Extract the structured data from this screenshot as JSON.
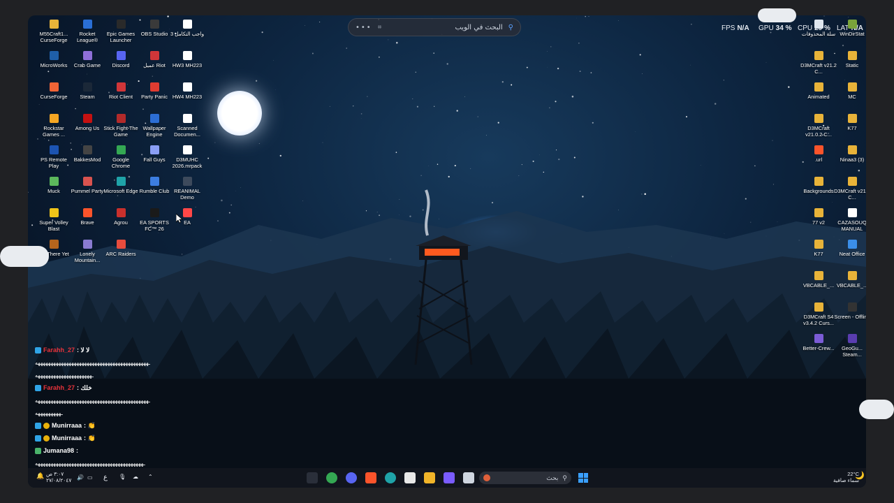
{
  "websearch": {
    "placeholder": "البحث في الويب",
    "more": "•••"
  },
  "stats": {
    "fps_label": "FPS",
    "fps": "N/A",
    "gpu_label": "GPU",
    "gpu": "34 %",
    "cpu_label": "CPU",
    "cpu": "29 %",
    "lat_label": "LAT",
    "lat": "N/A"
  },
  "desktop_left": [
    {
      "label": "M55Craft1... CurseForge",
      "icon": "folder-icon",
      "color": "#e8b339"
    },
    {
      "label": "Rocket League®",
      "icon": "rocket-league-icon",
      "color": "#2a6fd6"
    },
    {
      "label": "Epic Games Launcher",
      "icon": "epic-games-icon",
      "color": "#2a2a2a"
    },
    {
      "label": "OBS Studio",
      "icon": "obs-icon",
      "color": "#3a3a3a"
    },
    {
      "label": "واجب التكامل 3",
      "icon": "document-icon",
      "color": "#ffffff"
    },
    {
      "label": "MicroWorks",
      "icon": "microworks-icon",
      "color": "#1f5fa8"
    },
    {
      "label": "Crab Game",
      "icon": "crab-game-icon",
      "color": "#8f6fd8"
    },
    {
      "label": "Discord",
      "icon": "discord-icon",
      "color": "#5865f2"
    },
    {
      "label": "عميل Riot",
      "icon": "riot-icon",
      "color": "#d13639"
    },
    {
      "label": "HW3 MH223",
      "icon": "document-icon",
      "color": "#ffffff"
    },
    {
      "label": "CurseForge",
      "icon": "curseforge-icon",
      "color": "#f16436"
    },
    {
      "label": "Steam",
      "icon": "steam-icon",
      "color": "#1b2838"
    },
    {
      "label": "Riot Client",
      "icon": "riot-client-icon",
      "color": "#d13639"
    },
    {
      "label": "Party Panic",
      "icon": "party-panic-icon",
      "color": "#e03c31"
    },
    {
      "label": "HW4 MH223",
      "icon": "document-icon",
      "color": "#ffffff"
    },
    {
      "label": "Rockstar Games ...",
      "icon": "rockstar-icon",
      "color": "#f5a623"
    },
    {
      "label": "Among Us",
      "icon": "among-us-icon",
      "color": "#c51111"
    },
    {
      "label": "Stick Fight The Game",
      "icon": "stick-fight-icon",
      "color": "#b22a2a"
    },
    {
      "label": "Wallpaper Engine",
      "icon": "wallpaper-engine-icon",
      "color": "#2c6ed5"
    },
    {
      "label": "Scanned Documen...",
      "icon": "document-icon",
      "color": "#ffffff"
    },
    {
      "label": "PS Remote Play",
      "icon": "ps-remote-icon",
      "color": "#1c54b2"
    },
    {
      "label": "BakkesMod",
      "icon": "bakkesmod-icon",
      "color": "#444444"
    },
    {
      "label": "Google Chrome",
      "icon": "chrome-icon",
      "color": "#34a853"
    },
    {
      "label": "Fall Guys",
      "icon": "fall-guys-icon",
      "color": "#8a9ef5"
    },
    {
      "label": "D3MUHC 2026.mrpack",
      "icon": "file-icon",
      "color": "#ffffff"
    },
    {
      "label": "Muck",
      "icon": "muck-icon",
      "color": "#5cb85c"
    },
    {
      "label": "Pummel Party",
      "icon": "pummel-party-icon",
      "color": "#d9534f"
    },
    {
      "label": "Microsoft Edge",
      "icon": "edge-icon",
      "color": "#1fa3a8"
    },
    {
      "label": "Rumble Club",
      "icon": "rumble-club-icon",
      "color": "#3c7de0"
    },
    {
      "label": "REANIMAL Demo",
      "icon": "reanimal-icon",
      "color": "#3d4a5c"
    },
    {
      "label": "Super Volley Blast",
      "icon": "super-volley-icon",
      "color": "#f0c419"
    },
    {
      "label": "Brave",
      "icon": "brave-icon",
      "color": "#fb542b"
    },
    {
      "label": "Agrou",
      "icon": "agrou-icon",
      "color": "#c9302c"
    },
    {
      "label": "EA SPORTS FC™ 26",
      "icon": "ea-fc-icon",
      "color": "#1a1a1a"
    },
    {
      "label": "EA",
      "icon": "ea-icon",
      "color": "#ff4747"
    },
    {
      "label": "RV There Yet",
      "icon": "rv-there-yet-icon",
      "color": "#b5651d"
    },
    {
      "label": "Lonely Mountain...",
      "icon": "lonely-mountains-icon",
      "color": "#8a7bd1"
    },
    {
      "label": "ARC Raiders",
      "icon": "arc-raiders-icon",
      "color": "#e84c3d"
    }
  ],
  "desktop_right": [
    {
      "label": "سلة المحذوفات",
      "icon": "recycle-bin-icon",
      "color": "#dfe6ee"
    },
    {
      "label": "WinDirStat",
      "icon": "windirstat-icon",
      "color": "#7aa33a"
    },
    {
      "label": "D3MCraft v21.2 C...",
      "icon": "folder-icon",
      "color": "#e8b339"
    },
    {
      "label": "Static",
      "icon": "folder-icon",
      "color": "#e8b339"
    },
    {
      "label": "Animated",
      "icon": "folder-icon",
      "color": "#e8b339"
    },
    {
      "label": "MC",
      "icon": "folder-icon",
      "color": "#e8b339"
    },
    {
      "label": "D3MCraft v21.0.2 C...",
      "icon": "folder-icon",
      "color": "#e8b339"
    },
    {
      "label": "K77",
      "icon": "folder-icon",
      "color": "#e8b339"
    },
    {
      "label": ".url",
      "icon": "brave-icon",
      "color": "#fb542b"
    },
    {
      "label": "Ninaa3 (3)",
      "icon": "folder-icon",
      "color": "#e8b339"
    },
    {
      "label": "Backgrounds",
      "icon": "folder-icon",
      "color": "#e8b339"
    },
    {
      "label": "D3MCraft v21.1 C...",
      "icon": "folder-icon",
      "color": "#e8b339"
    },
    {
      "label": "77 v2",
      "icon": "folder-icon",
      "color": "#e8b339"
    },
    {
      "label": "CAZASOUQ MANUAL",
      "icon": "document-icon",
      "color": "#ffffff"
    },
    {
      "label": "K77",
      "icon": "folder-icon",
      "color": "#e8b339"
    },
    {
      "label": "Neat Office",
      "icon": "neat-office-icon",
      "color": "#3b8ee8"
    },
    {
      "label": "VBCABLE_...",
      "icon": "folder-icon",
      "color": "#e8b339"
    },
    {
      "label": "VBCABLE_...",
      "icon": "folder-icon",
      "color": "#e8b339"
    },
    {
      "label": "D3MCraft S4 v3.4.2 Curs...",
      "icon": "folder-icon",
      "color": "#e8b339"
    },
    {
      "label": "Screen - Offline",
      "icon": "screen-icon",
      "color": "#333333"
    },
    {
      "label": "Better-Crew...",
      "icon": "better-crew-icon",
      "color": "#7b5cd6"
    },
    {
      "label": "GeoGu... Steam...",
      "icon": "geoguessr-icon",
      "color": "#5a3db0"
    }
  ],
  "chat": [
    {
      "name": "Farahh_27",
      "name_color": "#e8333b",
      "msg": ": لا لا",
      "badges": [
        "prime"
      ]
    },
    {
      "spam": "ـهههههههههههههههههههههههههههههههههههههههههههه"
    },
    {
      "spam": "ـهههههههههههههههههههههه"
    },
    {
      "name": "Farahh_27",
      "name_color": "#e8333b",
      "msg": ": خلك",
      "badges": [
        "prime"
      ]
    },
    {
      "spam": "ـهههههههههههههههههههههههههههههههههههههههههههه"
    },
    {
      "spam": "ـهههههههههه"
    },
    {
      "name": "Munirraaa",
      "name_color": "#ffffff",
      "msg": ": 👏",
      "badges": [
        "prime",
        "sub"
      ]
    },
    {
      "name": "Munirraaa",
      "name_color": "#ffffff",
      "msg": ": 👏",
      "badges": [
        "prime",
        "sub"
      ]
    },
    {
      "name": "Jumana98",
      "name_color": "#ffffff",
      "msg": ":",
      "badges": [
        "bits"
      ]
    },
    {
      "spam": "ـهههههههههههههههههههههههههههههههههههههههههه"
    }
  ],
  "taskbar": {
    "search_placeholder": "بحث",
    "clock_time": "٣:٠٧ ص",
    "clock_date": "٢٧/٠٨/٢٠٤٧",
    "lang": "ع",
    "weather_temp": "22°C",
    "weather_desc": "سماء صافية",
    "apps": [
      "steam-like-icon",
      "chrome-icon",
      "discord-icon",
      "brave-icon",
      "edge-icon",
      "store-icon",
      "file-explorer-icon",
      "copilot-icon",
      "window-icon"
    ]
  }
}
